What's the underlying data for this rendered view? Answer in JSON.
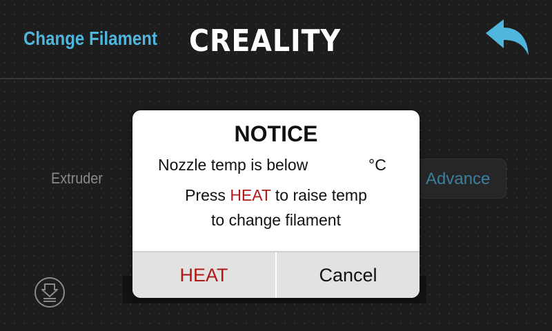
{
  "header": {
    "title": "Change Filament",
    "brand": "CREALITY",
    "back_icon": "back-arrow-icon"
  },
  "main": {
    "extruder_label": "Extruder",
    "advance_label": "Advance",
    "bottom_icon": "extrude-icon"
  },
  "dialog": {
    "title": "NOTICE",
    "line1": "Nozzle temp is below",
    "line1_unit": "°C",
    "line2_prefix": "Press ",
    "line2_highlight": "HEAT",
    "line2_suffix": " to raise temp",
    "line3": "to change filament",
    "heat_button": "HEAT",
    "cancel_button": "Cancel"
  },
  "colors": {
    "accent_blue": "#4fb6dd",
    "heat_red": "#b01818",
    "background": "#1d1d1d"
  }
}
